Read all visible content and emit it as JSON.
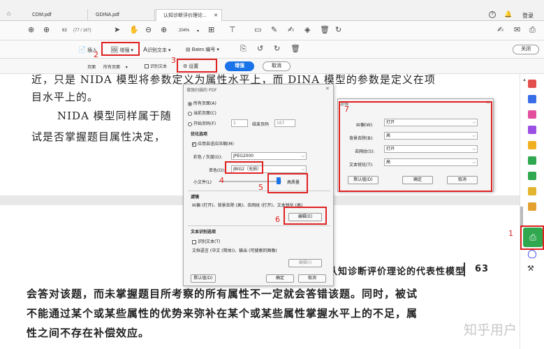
{
  "tabs": [
    {
      "label": "CDM.pdf"
    },
    {
      "label": "GDINA.pdf"
    },
    {
      "label": "认知诊断评价理论..."
    }
  ],
  "header": {
    "help_icon": "?",
    "login": "登录"
  },
  "nav": {
    "page_current": "63",
    "page_total": "(77 / 167)",
    "zoom": "204%"
  },
  "toolbar2": {
    "insert": "插入",
    "enhance": "增强",
    "ocr_text": "识别文本",
    "bates": "Bates 编号",
    "close": "关闭"
  },
  "toolbar3": {
    "pages_label": "页面",
    "pages_value": "所有页面",
    "ocr_text": "识别文本",
    "settings": "设置",
    "enhance_btn": "增强",
    "cancel_btn": "取消"
  },
  "doc": {
    "line1": "近，只是 NIDA 模型将参数定义为属性水平上，而 DINA 模型的参数是定义在项",
    "line2": "目水平上的。",
    "line3": "NIDA 模型同样属于随",
    "line4": "试是否掌握题目属性决定，",
    "header_title": "认知诊断评价理论的代表性模型",
    "page_number": "63",
    "p1": "会答对该题，而未掌握题目所考察的所有属性不一定就会答错该题。同时，被试",
    "p2": "不能通过某个或某些属性的优势来弥补在某个或某些属性掌握水平上的不足，属",
    "p3": "性之间不存在补偿效应。",
    "watermark": "知乎用户"
  },
  "dialog1": {
    "title": "增强扫描的 PDF",
    "all_pages": "所有页面(A)",
    "current_page": "当前页面(C)",
    "start_page": "开始页码(F)",
    "start_value": "1",
    "end_page": "结束页码",
    "end_value": "167",
    "optimize": "优化选项",
    "adaptive": "应用自适应压缩(M)",
    "color_label": "彩色 / 灰度(G):",
    "color_value": "JPEG2000",
    "mono_label": "单色(O):",
    "mono_value": "JBIG2（无损）",
    "small_file": "小文件(L)",
    "high_quality": "高质量",
    "filters": "滤镜",
    "filters_desc": "纠偏 (打开)、背景去除 (高)、去网纹 (打开)、文本锐化 (高)",
    "edit_btn": "编辑(E)",
    "ocr_section": "文本识别选项",
    "ocr_check": "识别文本(T)",
    "ocr_desc": "文档语言 (中文 (简体))、输出 (可搜索的图像)",
    "ocr_edit": "编辑(I)",
    "default_btn": "默认值(D)",
    "ok_btn": "确定",
    "cancel_btn": "取消"
  },
  "dialog2": {
    "title": "滤镜",
    "rows": [
      {
        "label": "纠偏(W):",
        "value": "打开"
      },
      {
        "label": "背景去除(B):",
        "value": "高"
      },
      {
        "label": "去网纹(S):",
        "value": "打开"
      },
      {
        "label": "文本锐化(T):",
        "value": "高"
      }
    ],
    "default_btn": "默认值(D)",
    "ok_btn": "确定",
    "cancel_btn": "取消"
  },
  "annotations": [
    "1",
    "2",
    "3",
    "4",
    "5",
    "6",
    "7"
  ],
  "colors": {
    "annotation": "#e02020",
    "accent": "#1a73e8"
  }
}
